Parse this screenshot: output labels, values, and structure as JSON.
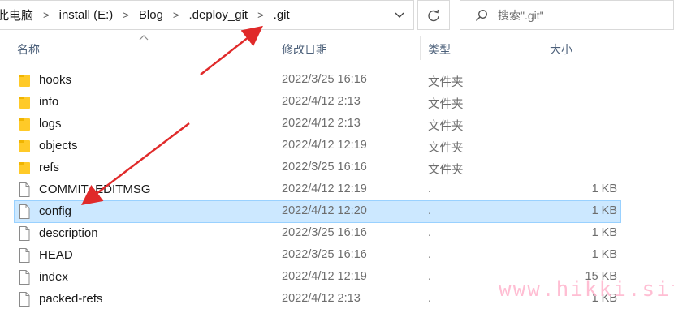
{
  "address_bar": {
    "crumbs": [
      "此电脑",
      "install (E:)",
      "Blog",
      ".deploy_git",
      ".git"
    ],
    "separator": ">"
  },
  "search": {
    "placeholder": "搜索\".git\""
  },
  "columns": {
    "name": "名称",
    "date": "修改日期",
    "type": "类型",
    "size": "大小"
  },
  "files": [
    {
      "name": "hooks",
      "date": "2022/3/25 16:16",
      "type": "文件夹",
      "size": "",
      "icon": "folder-icon"
    },
    {
      "name": "info",
      "date": "2022/4/12 2:13",
      "type": "文件夹",
      "size": "",
      "icon": "folder-icon"
    },
    {
      "name": "logs",
      "date": "2022/4/12 2:13",
      "type": "文件夹",
      "size": "",
      "icon": "folder-icon"
    },
    {
      "name": "objects",
      "date": "2022/4/12 12:19",
      "type": "文件夹",
      "size": "",
      "icon": "folder-icon"
    },
    {
      "name": "refs",
      "date": "2022/3/25 16:16",
      "type": "文件夹",
      "size": "",
      "icon": "folder-icon"
    },
    {
      "name": "COMMIT_EDITMSG",
      "date": "2022/4/12 12:19",
      "type": ".",
      "size": "1 KB",
      "icon": "file-icon"
    },
    {
      "name": "config",
      "date": "2022/4/12 12:20",
      "type": ".",
      "size": "1 KB",
      "icon": "file-icon",
      "selected": true
    },
    {
      "name": "description",
      "date": "2022/3/25 16:16",
      "type": ".",
      "size": "1 KB",
      "icon": "file-icon"
    },
    {
      "name": "HEAD",
      "date": "2022/3/25 16:16",
      "type": ".",
      "size": "1 KB",
      "icon": "file-icon"
    },
    {
      "name": "index",
      "date": "2022/4/12 12:19",
      "type": ".",
      "size": "15 KB",
      "icon": "file-icon"
    },
    {
      "name": "packed-refs",
      "date": "2022/4/12 2:13",
      "type": ".",
      "size": "1 KB",
      "icon": "file-icon"
    }
  ],
  "watermark": "www.hikki.site",
  "colors": {
    "selection": "#cce8ff",
    "arrow": "#e02a2a",
    "folder": "#ffca28",
    "watermark": "#ffb7cf"
  }
}
